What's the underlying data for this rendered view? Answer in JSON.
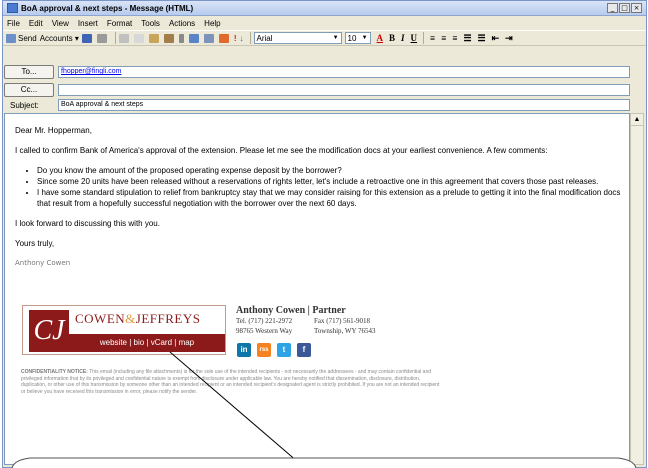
{
  "window": {
    "title": "BoA approval & next steps - Message (HTML)",
    "min": "_",
    "max": "□",
    "close": "×"
  },
  "menu": [
    "File",
    "Edit",
    "View",
    "Insert",
    "Format",
    "Tools",
    "Actions",
    "Help"
  ],
  "toolbar": {
    "send": "Send",
    "accounts": "Accounts ▾",
    "font": "Arial",
    "size": "10"
  },
  "headers": {
    "to_label": "To...",
    "to_value": "fhopper@fingli.com",
    "cc_label": "Cc...",
    "cc_value": "",
    "subject_label": "Subject:",
    "subject_value": "BoA approval & next steps"
  },
  "body": {
    "greeting": "Dear Mr. Hopperman,",
    "para1": "I called to confirm Bank of America's approval of the extension.   Please let me see the modification docs at your earliest convenience.  A few comments:",
    "bullets": [
      "Do you know the amount of the proposed operating expense deposit by the borrower?",
      "Since some 20 units have been released without a reservations of rights letter, let's include a retroactive one in this agreement that covers those past releases.",
      "I have some standard stipulation to relief from bankruptcy stay that we may consider raising for this extension as a prelude to getting it into the final modification docs that result from a hopefully successful negotiation with the borrower over the next 60 days."
    ],
    "closing1": "I look forward to discussing this with you.",
    "closing2": "Yours truly,",
    "signature": "Anthony Cowen"
  },
  "logo": {
    "monogram": "CJ",
    "name_left": "COWEN",
    "amp": "&",
    "name_right": "JEFFREYS",
    "links": "website | bio | vCard | map"
  },
  "card": {
    "name": "Anthony Cowen | Partner",
    "tel": "Tel. (717) 221-2972",
    "fax": "Fax (717) 561-9018",
    "address": "98765 Western Way",
    "city": "Township, WY 76543"
  },
  "social": [
    "in",
    "rss",
    "t",
    "f"
  ],
  "notice": {
    "label": "CONFIDENTIALITY NOTICE:",
    "text": "This email (including any file attachments) is for the sole use of the intended recipients - not necessarily the addressees - and may contain confidential and privileged information that by its privileged and confidential nature is exempt from disclosure under applicable law.  You are hereby notified that dissemination, disclosure, distribution, duplication, or other use of this transmission by someone other than an intended recipient or an intended recipient's designated agent is strictly prohibited.  If you are not an intended recipient or believe you have received this transmission in error, please notify the sender."
  }
}
